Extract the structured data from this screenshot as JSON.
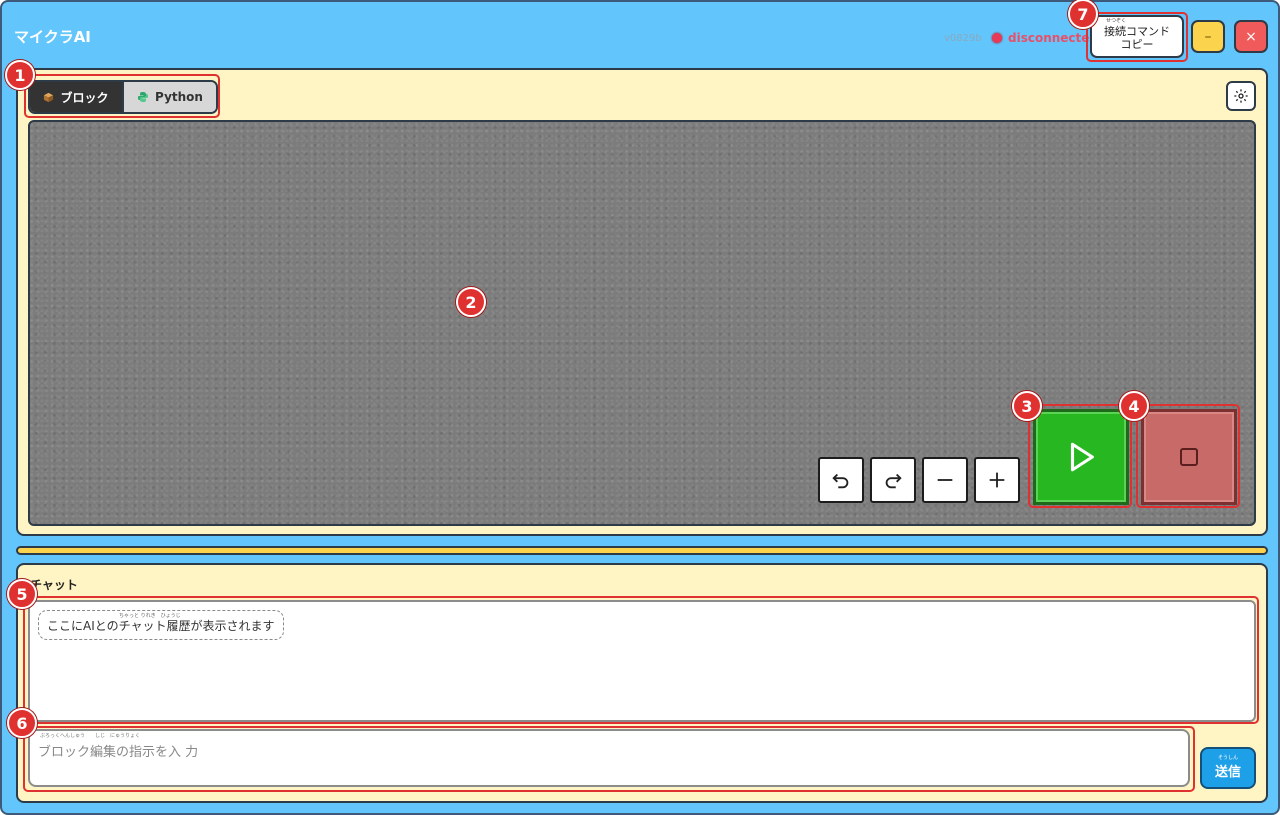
{
  "app": {
    "title": "マイクラAI",
    "version": "v0829b",
    "status": "disconnected",
    "status_color": "#e83a58"
  },
  "titlebar": {
    "copy_command_ruby": "せつぞく",
    "copy_command_line1": "接続コマンド",
    "copy_command_line2": "コピー",
    "minimize_label": "–",
    "close_label": "×"
  },
  "editor": {
    "modes": [
      {
        "label": "ブロック",
        "icon": "cube-icon",
        "active": true
      },
      {
        "label": "Python",
        "icon": "python-icon",
        "active": false
      }
    ],
    "settings_icon": "gear-icon",
    "tools": [
      {
        "name": "undo",
        "icon": "undo-icon"
      },
      {
        "name": "redo",
        "icon": "redo-icon"
      },
      {
        "name": "zoom-out",
        "icon": "minus-icon"
      },
      {
        "name": "zoom-in",
        "icon": "plus-icon"
      }
    ],
    "run_icon": "play-icon",
    "stop_icon": "stop-icon",
    "run_color": "#27b821",
    "stop_color": "#c76a68"
  },
  "chat": {
    "title": "チャット",
    "history_placeholder": "ここにAIとのチャット履歴が表示されます",
    "history_ruby": "ちゃっと りれき　ひょうじ",
    "input_placeholder": "ブロック編集の指示を入 力",
    "input_ruby": "ぶろっくへんしゅう　　しじ　にゅうりょく",
    "send_ruby": "そうしん",
    "send_label": "送信",
    "send_color": "#1ea0e8"
  },
  "annotations": {
    "colors": {
      "badge": "#e03131"
    },
    "labels": [
      "1",
      "2",
      "3",
      "4",
      "5",
      "6",
      "7"
    ]
  }
}
